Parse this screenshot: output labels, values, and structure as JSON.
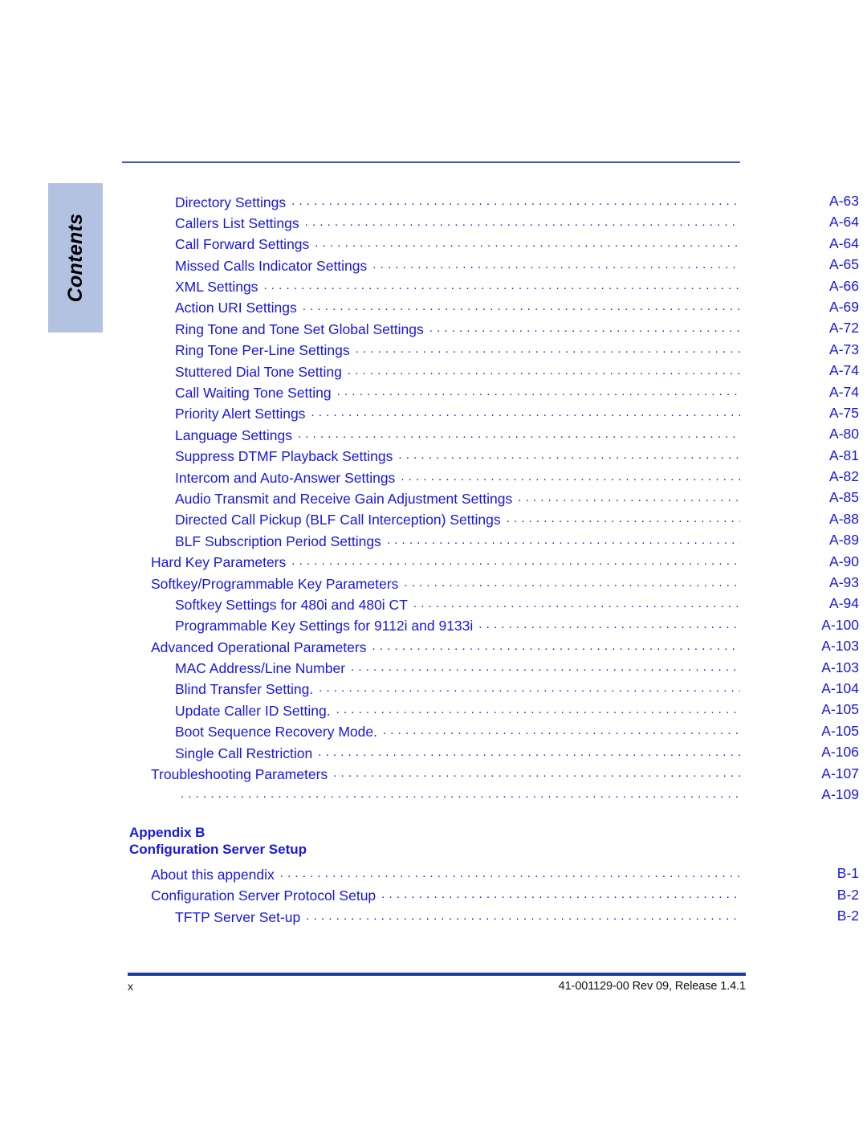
{
  "side_tab": {
    "label": "Contents"
  },
  "colors": {
    "link_blue": "#1616e8",
    "rule_blue": "#3b5bc0",
    "footer_rule_blue": "#1c3d9e",
    "tab_bg": "#b4c2e2"
  },
  "toc": {
    "entries": [
      {
        "level": 2,
        "title": "Directory Settings",
        "page": "A-63"
      },
      {
        "level": 2,
        "title": "Callers List Settings",
        "page": "A-64"
      },
      {
        "level": 2,
        "title": "Call Forward Settings",
        "page": "A-64"
      },
      {
        "level": 2,
        "title": "Missed Calls Indicator Settings",
        "page": "A-65"
      },
      {
        "level": 2,
        "title": "XML Settings",
        "page": "A-66"
      },
      {
        "level": 2,
        "title": "Action URI Settings",
        "page": "A-69"
      },
      {
        "level": 2,
        "title": "Ring Tone and Tone Set Global Settings",
        "page": "A-72"
      },
      {
        "level": 2,
        "title": "Ring Tone Per-Line Settings",
        "page": "A-73"
      },
      {
        "level": 2,
        "title": "Stuttered Dial Tone Setting",
        "page": "A-74"
      },
      {
        "level": 2,
        "title": "Call Waiting Tone Setting",
        "page": "A-74"
      },
      {
        "level": 2,
        "title": "Priority Alert Settings",
        "page": "A-75"
      },
      {
        "level": 2,
        "title": "Language Settings",
        "page": "A-80"
      },
      {
        "level": 2,
        "title": "Suppress DTMF Playback Settings",
        "page": "A-81"
      },
      {
        "level": 2,
        "title": "Intercom and Auto-Answer Settings",
        "page": "A-82"
      },
      {
        "level": 2,
        "title": "Audio Transmit and Receive Gain Adjustment Settings",
        "page": "A-85"
      },
      {
        "level": 2,
        "title": "Directed Call Pickup (BLF Call Interception) Settings",
        "page": "A-88"
      },
      {
        "level": 2,
        "title": "BLF Subscription Period Settings",
        "page": "A-89"
      },
      {
        "level": 1,
        "title": "Hard Key Parameters",
        "page": "A-90"
      },
      {
        "level": 1,
        "title": "Softkey/Programmable Key Parameters",
        "page": "A-93"
      },
      {
        "level": 2,
        "title": "Softkey Settings for 480i and 480i CT",
        "page": "A-94"
      },
      {
        "level": 2,
        "title": "Programmable Key Settings for 9112i and 9133i",
        "page": "A-100"
      },
      {
        "level": 1,
        "title": "Advanced Operational Parameters",
        "page": "A-103"
      },
      {
        "level": 2,
        "title": "MAC Address/Line Number",
        "page": "A-103"
      },
      {
        "level": 2,
        "title": "Blind Transfer Setting.",
        "page": "A-104"
      },
      {
        "level": 2,
        "title": "Update Caller ID Setting.",
        "page": "A-105"
      },
      {
        "level": 2,
        "title": "Boot Sequence Recovery Mode.",
        "page": "A-105"
      },
      {
        "level": 2,
        "title": "Single Call Restriction",
        "page": "A-106"
      },
      {
        "level": 1,
        "title": "Troubleshooting Parameters",
        "page": "A-107"
      },
      {
        "level": 2,
        "title": "",
        "page": "A-109"
      }
    ]
  },
  "appendix": {
    "heading_line1": "Appendix B",
    "heading_line2": "Configuration Server Setup",
    "entries": [
      {
        "level": 1,
        "title": "About this appendix",
        "page": "B-1"
      },
      {
        "level": 1,
        "title": "Configuration Server Protocol Setup",
        "page": "B-2"
      },
      {
        "level": 2,
        "title": "TFTP Server Set-up",
        "page": "B-2"
      }
    ]
  },
  "footer": {
    "page_number": "x",
    "doc_reference": "41-001129-00 Rev 09, Release 1.4.1"
  }
}
